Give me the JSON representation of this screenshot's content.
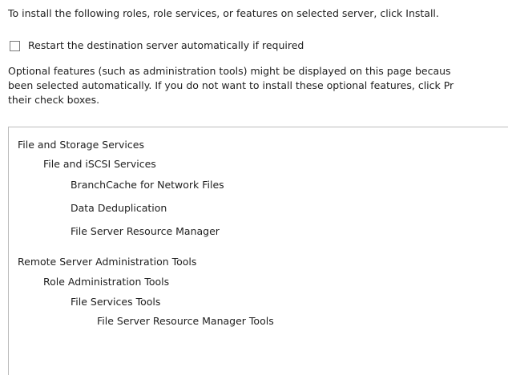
{
  "intro_text": "To install the following roles, role services, or features on selected server, click Install.",
  "restart": {
    "label": "Restart the destination server automatically if required",
    "checked": false
  },
  "optional_note": {
    "line1": "Optional features (such as administration tools) might be displayed on this page becaus",
    "line2": "been selected automatically. If you do not want to install these optional features, click Pr",
    "line3": "their check boxes."
  },
  "features": [
    {
      "label": "File and Storage Services",
      "level": 0
    },
    {
      "label": "File and iSCSI Services",
      "level": 1
    },
    {
      "label": "BranchCache for Network Files",
      "level": 2
    },
    {
      "label": "Data Deduplication",
      "level": 2
    },
    {
      "label": "File Server Resource Manager",
      "level": 2
    },
    {
      "label": "Remote Server Administration Tools",
      "level": 0
    },
    {
      "label": "Role Administration Tools",
      "level": 1
    },
    {
      "label": "File Services Tools",
      "level": 2
    },
    {
      "label": "File Server Resource Manager Tools",
      "level": 3
    }
  ]
}
